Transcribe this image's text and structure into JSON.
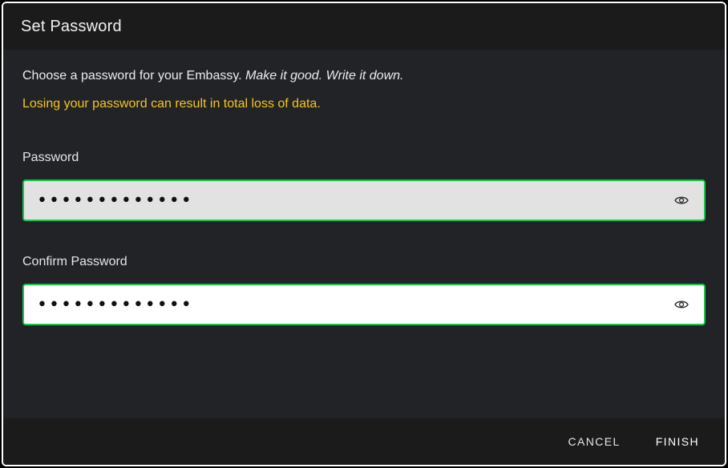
{
  "dialog": {
    "title": "Set Password"
  },
  "intro": {
    "text": "Choose a password for your Embassy.",
    "emphasis": "Make it good. Write it down."
  },
  "warning": {
    "text": "Losing your password can result in total loss of data.",
    "color": "#f3c622"
  },
  "password": {
    "label": "Password",
    "value": "aaaaaaaaaaaaa",
    "visibility_icon": "eye-icon"
  },
  "confirm_password": {
    "label": "Confirm Password",
    "value": "aaaaaaaaaaaaa",
    "visibility_icon": "eye-icon"
  },
  "footer": {
    "cancel_label": "CANCEL",
    "finish_label": "FINISH"
  },
  "colors": {
    "field_border": "#19c34a",
    "background": "#222326",
    "header_footer": "#1b1b1c"
  }
}
